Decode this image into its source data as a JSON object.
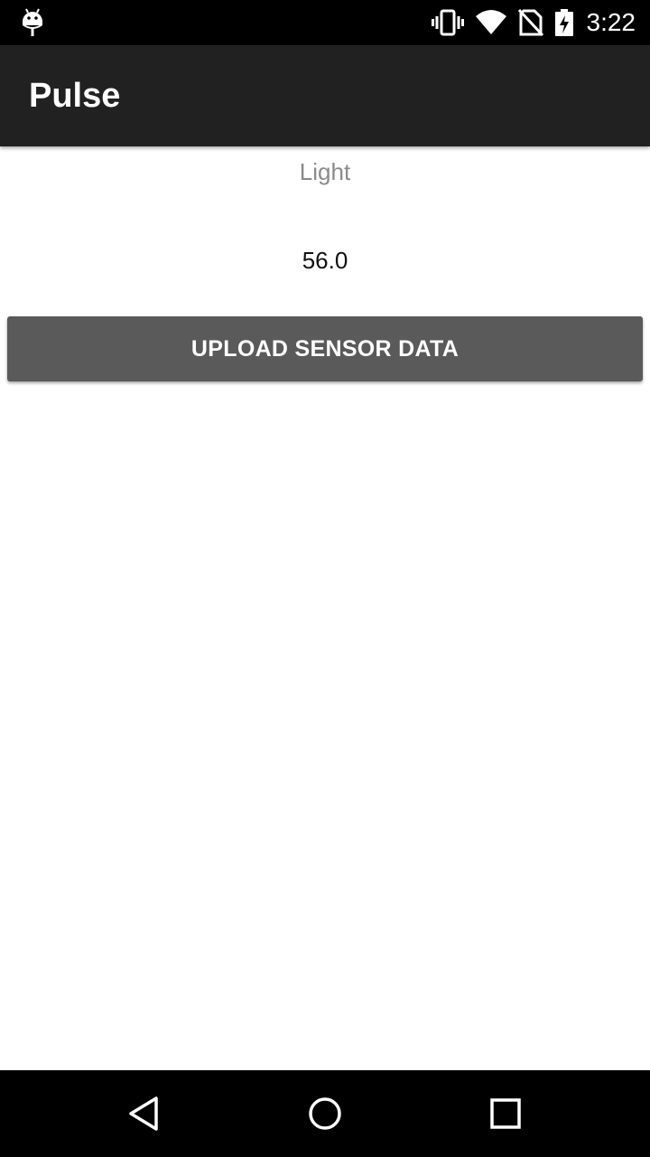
{
  "status_bar": {
    "time": "3:22",
    "icons": [
      "android-debug-icon",
      "vibrate-icon",
      "wifi-icon",
      "no-sim-icon",
      "battery-charging-icon"
    ]
  },
  "app_bar": {
    "title": "Pulse"
  },
  "sensor": {
    "label": "Light",
    "value": "56.0"
  },
  "actions": {
    "upload_label": "UPLOAD SENSOR DATA"
  },
  "nav_bar": {
    "icons": [
      "back-icon",
      "home-icon",
      "recents-icon"
    ]
  },
  "colors": {
    "status_bar": "#000000",
    "app_bar": "#212121",
    "button": "#5a5a5a",
    "label_gray": "#8a8a8a"
  }
}
